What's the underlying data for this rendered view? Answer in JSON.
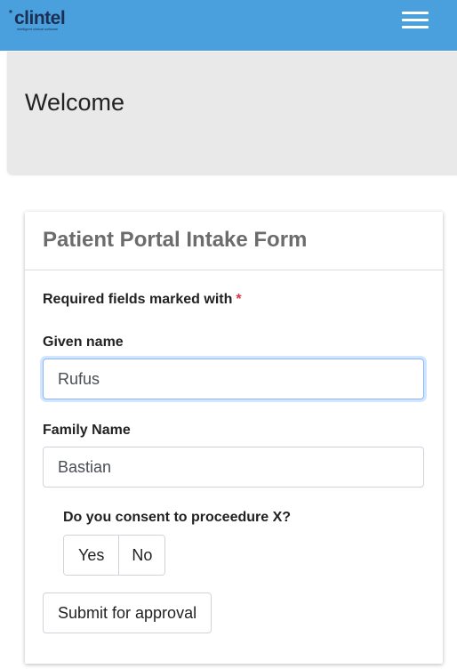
{
  "header": {
    "logo_mark": "*",
    "logo_text": "clintel",
    "logo_tagline": "intelligent clinical software",
    "menu_icon": "hamburger-menu-icon",
    "background_color": "#4a9fdd"
  },
  "welcome": {
    "title": "Welcome"
  },
  "form": {
    "title": "Patient Portal Intake Form",
    "required_note": "Required fields marked with",
    "required_marker": "*",
    "given_name": {
      "label": "Given name",
      "value": "Rufus"
    },
    "family_name": {
      "label": "Family Name",
      "value": "Bastian"
    },
    "consent": {
      "question": "Do you consent to proceedure X?",
      "options": [
        "Yes",
        "No"
      ]
    },
    "submit_label": "Submit for approval"
  }
}
